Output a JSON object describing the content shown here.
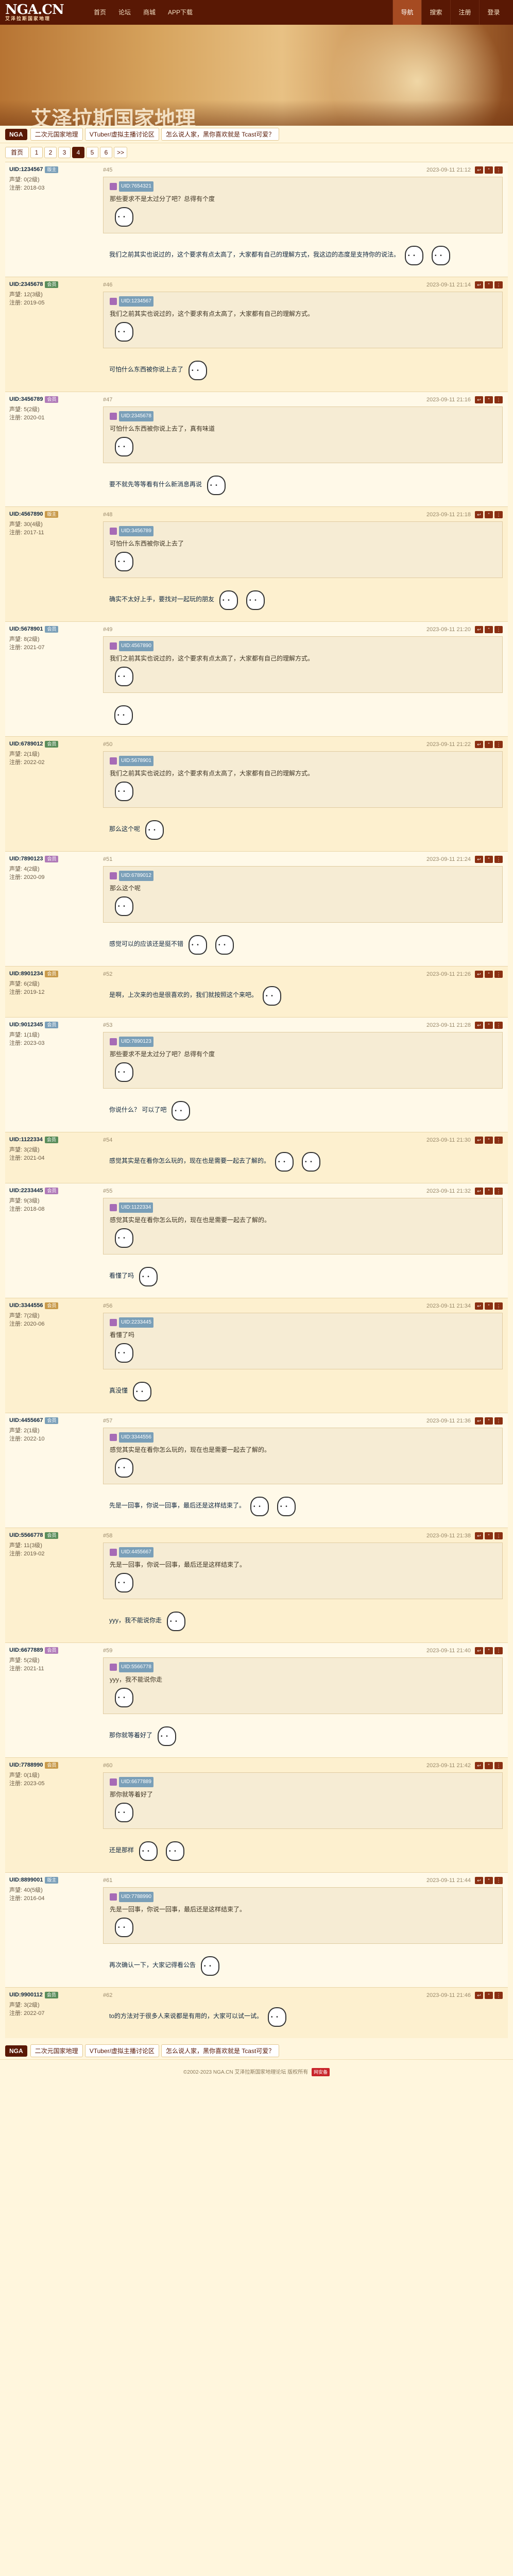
{
  "header": {
    "logo": "NGA.CN",
    "logo_sub": "艾泽拉斯国家地理",
    "nav": [
      "首页",
      "论坛",
      "商城",
      "APP下载"
    ],
    "right_tabs": [
      "导航",
      "搜索",
      "注册",
      "登录"
    ]
  },
  "banner": {
    "title": "艾泽拉斯国家地理"
  },
  "crumbs": {
    "home": "NGA",
    "items": [
      "二次元国家地理",
      "VTuber/虚拟主播讨论区",
      "怎么说人家，黑你喜欢就是 Tcast可爱？"
    ]
  },
  "pager": {
    "first": "首页",
    "pages": [
      "1",
      "2",
      "3",
      "4",
      "5",
      "6"
    ],
    "current": "4",
    "next": ">>",
    "last": "末页"
  },
  "posts": [
    {
      "floor": "#45",
      "user": "UID:1234567",
      "badge": "版主",
      "level": "声望: 0(2级)",
      "regdate": "注册: 2018-03",
      "time": "2023-09-11 21:12",
      "quote_user": "UID:7654321",
      "quote_text": "那些要求不是太过分了吧？总得有个度",
      "text": "我们之前其实也说过的，这个要求有点太高了，大家都有自己的理解方式，我这边的态度是支持你的说法。"
    },
    {
      "floor": "#46",
      "user": "UID:2345678",
      "badge": "会员",
      "level": "声望: 12(3级)",
      "regdate": "注册: 2019-05",
      "time": "2023-09-11 21:14",
      "quote_user": "UID:1234567",
      "quote_text": "我们之前其实也说过的，这个要求有点太高了，大家都有自己的理解方式。",
      "text": "可怕什么东西被你说上去了"
    },
    {
      "floor": "#47",
      "user": "UID:3456789",
      "badge": "会员",
      "level": "声望: 5(2级)",
      "regdate": "注册: 2020-01",
      "time": "2023-09-11 21:16",
      "quote_user": "UID:2345678",
      "quote_text": "可怕什么东西被你说上去了，真有味道",
      "text": "要不就先等等看有什么新消息再说"
    },
    {
      "floor": "#48",
      "user": "UID:4567890",
      "badge": "版主",
      "level": "声望: 30(4级)",
      "regdate": "注册: 2017-11",
      "time": "2023-09-11 21:18",
      "quote_user": "UID:3456789",
      "quote_text": "可怕什么东西被你说上去了",
      "text": "确实不太好上手，要找对一起玩的朋友"
    },
    {
      "floor": "#49",
      "user": "UID:5678901",
      "badge": "会员",
      "level": "声望: 8(2级)",
      "regdate": "注册: 2021-07",
      "time": "2023-09-11 21:20",
      "quote_user": "UID:4567890",
      "quote_text": "我们之前其实也说过的，这个要求有点太高了，大家都有自己的理解方式。",
      "text": ""
    },
    {
      "floor": "#50",
      "user": "UID:6789012",
      "badge": "会员",
      "level": "声望: 2(1级)",
      "regdate": "注册: 2022-02",
      "time": "2023-09-11 21:22",
      "quote_user": "UID:5678901",
      "quote_text": "我们之前其实也说过的，这个要求有点太高了，大家都有自己的理解方式。",
      "text": "那么这个呢"
    },
    {
      "floor": "#51",
      "user": "UID:7890123",
      "badge": "会员",
      "level": "声望: 4(2级)",
      "regdate": "注册: 2020-09",
      "time": "2023-09-11 21:24",
      "quote_user": "UID:6789012",
      "quote_text": "那么这个呢",
      "text": "感觉可以的应该还是挺不错"
    },
    {
      "floor": "#52",
      "user": "UID:8901234",
      "badge": "会员",
      "level": "声望: 6(2级)",
      "regdate": "注册: 2019-12",
      "time": "2023-09-11 21:26",
      "quote_user": "",
      "quote_text": "",
      "text": "是啊，上次来的也是很喜欢的，我们就按照这个来吧。"
    },
    {
      "floor": "#53",
      "user": "UID:9012345",
      "badge": "会员",
      "level": "声望: 1(1级)",
      "regdate": "注册: 2023-03",
      "time": "2023-09-11 21:28",
      "quote_user": "UID:7890123",
      "quote_text": "那些要求不是太过分了吧？总得有个度",
      "text": "你说什么？ 可以了吧"
    },
    {
      "floor": "#54",
      "user": "UID:1122334",
      "badge": "会员",
      "level": "声望: 3(2级)",
      "regdate": "注册: 2021-04",
      "time": "2023-09-11 21:30",
      "quote_user": "",
      "quote_text": "",
      "text": "感觉其实是在看你怎么玩的，现在也是需要一起去了解的。"
    },
    {
      "floor": "#55",
      "user": "UID:2233445",
      "badge": "会员",
      "level": "声望: 9(3级)",
      "regdate": "注册: 2018-08",
      "time": "2023-09-11 21:32",
      "quote_user": "UID:1122334",
      "quote_text": "感觉其实是在看你怎么玩的，现在也是需要一起去了解的。",
      "text": "看懂了吗"
    },
    {
      "floor": "#56",
      "user": "UID:3344556",
      "badge": "会员",
      "level": "声望: 7(2级)",
      "regdate": "注册: 2020-06",
      "time": "2023-09-11 21:34",
      "quote_user": "UID:2233445",
      "quote_text": "看懂了吗",
      "text": "真没懂"
    },
    {
      "floor": "#57",
      "user": "UID:4455667",
      "badge": "会员",
      "level": "声望: 2(1级)",
      "regdate": "注册: 2022-10",
      "time": "2023-09-11 21:36",
      "quote_user": "UID:3344556",
      "quote_text": "感觉其实是在看你怎么玩的，现在也是需要一起去了解的。",
      "text": "先是一回事，你说一回事，最后还是这样结束了。"
    },
    {
      "floor": "#58",
      "user": "UID:5566778",
      "badge": "会员",
      "level": "声望: 11(3级)",
      "regdate": "注册: 2019-02",
      "time": "2023-09-11 21:38",
      "quote_user": "UID:4455667",
      "quote_text": "先是一回事，你说一回事，最后还是这样结束了。",
      "text": "yyy，我不能说你走"
    },
    {
      "floor": "#59",
      "user": "UID:6677889",
      "badge": "会员",
      "level": "声望: 5(2级)",
      "regdate": "注册: 2021-11",
      "time": "2023-09-11 21:40",
      "quote_user": "UID:5566778",
      "quote_text": "yyy，我不能说你走",
      "text": "那你就等着好了"
    },
    {
      "floor": "#60",
      "user": "UID:7788990",
      "badge": "会员",
      "level": "声望: 0(1级)",
      "regdate": "注册: 2023-05",
      "time": "2023-09-11 21:42",
      "quote_user": "UID:6677889",
      "quote_text": "那你就等着好了",
      "text": "还是那样"
    },
    {
      "floor": "#61",
      "user": "UID:8899001",
      "badge": "版主",
      "level": "声望: 40(5级)",
      "regdate": "注册: 2016-04",
      "time": "2023-09-11 21:44",
      "quote_user": "UID:7788990",
      "quote_text": "先是一回事，你说一回事，最后还是这样结束了。",
      "text": "再次确认一下，大家记得看公告"
    },
    {
      "floor": "#62",
      "user": "UID:9900112",
      "badge": "会员",
      "level": "声望: 3(2级)",
      "regdate": "注册: 2022-07",
      "time": "2023-09-11 21:46",
      "quote_user": "",
      "quote_text": "",
      "text": "to的方法对于很多人来说都是有用的，大家可以试一试。"
    }
  ],
  "footer": {
    "copyright": "©2002-2023 NGA.CN 艾泽拉斯国家地理论坛 版权所有",
    "stamp": "网安备"
  }
}
